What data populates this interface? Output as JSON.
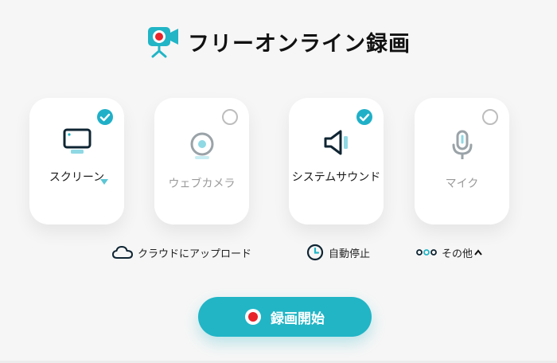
{
  "header": {
    "logo_icon": "camera-record-icon",
    "title": "フリーオンライン録画"
  },
  "sources": [
    {
      "id": "screen",
      "label": "スクリーン",
      "icon": "monitor-icon",
      "selected": true,
      "has_dropdown": true
    },
    {
      "id": "webcam",
      "label": "ウェブカメラ",
      "icon": "webcam-icon",
      "selected": false,
      "has_dropdown": false
    },
    {
      "id": "system-sound",
      "label": "システムサウンド",
      "icon": "speaker-icon",
      "selected": true,
      "has_dropdown": false
    },
    {
      "id": "mic",
      "label": "マイク",
      "icon": "microphone-icon",
      "selected": false,
      "has_dropdown": false
    }
  ],
  "options": {
    "cloud_upload": "クラウドにアップロード",
    "auto_stop": "自動停止",
    "more": "その他"
  },
  "record_button": {
    "label": "録画開始"
  },
  "colors": {
    "accent": "#21b5c6",
    "record_red": "#e8232a",
    "inactive_gray": "#9a9a9a"
  }
}
